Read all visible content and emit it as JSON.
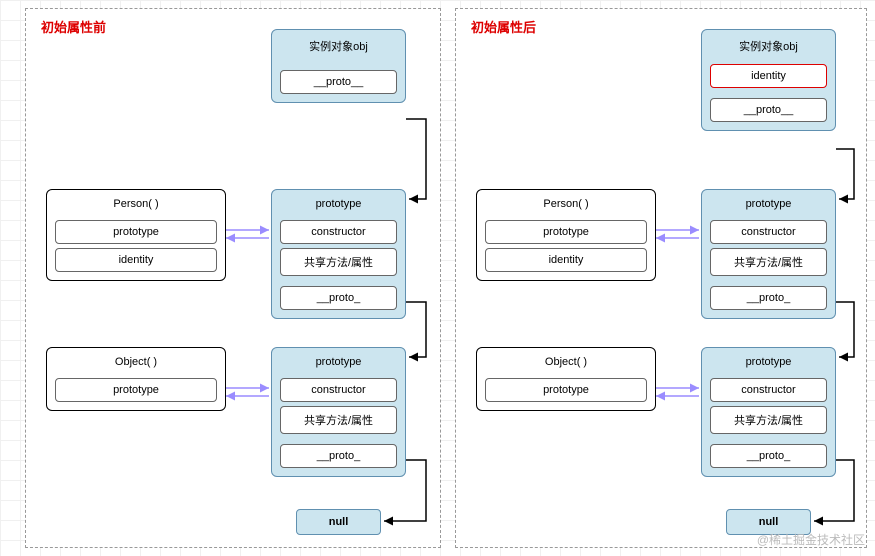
{
  "left": {
    "title": "初始属性前",
    "obj": {
      "header": "实例对象obj",
      "proto": "__proto__"
    },
    "person": {
      "header": "Person( )",
      "prototype": "prototype",
      "identity": "identity"
    },
    "proto1": {
      "header": "prototype",
      "constructor": "constructor",
      "shared": "共享方法/属性",
      "proto": "__proto_"
    },
    "object": {
      "header": "Object( )",
      "prototype": "prototype"
    },
    "proto2": {
      "header": "prototype",
      "constructor": "constructor",
      "shared": "共享方法/属性",
      "proto": "__proto_"
    },
    "null": "null"
  },
  "right": {
    "title": "初始属性后",
    "obj": {
      "header": "实例对象obj",
      "identity": "identity",
      "proto": "__proto__"
    },
    "person": {
      "header": "Person( )",
      "prototype": "prototype",
      "identity": "identity"
    },
    "proto1": {
      "header": "prototype",
      "constructor": "constructor",
      "shared": "共享方法/属性",
      "proto": "__proto_"
    },
    "object": {
      "header": "Object( )",
      "prototype": "prototype"
    },
    "proto2": {
      "header": "prototype",
      "constructor": "constructor",
      "shared": "共享方法/属性",
      "proto": "__proto_"
    },
    "null": "null"
  },
  "watermark": "@稀土掘金技术社区"
}
